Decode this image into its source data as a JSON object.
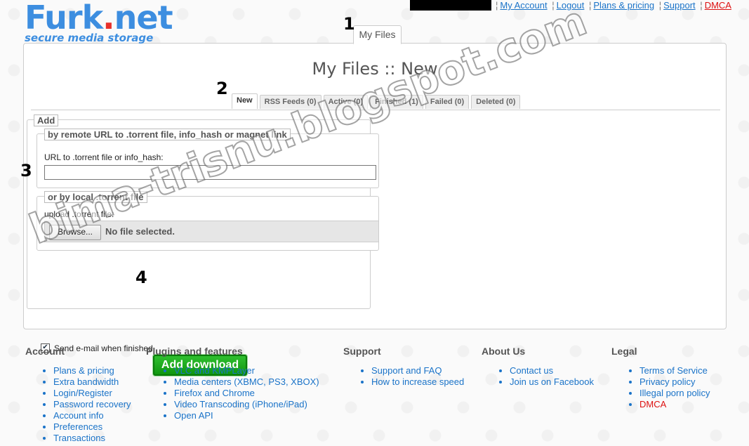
{
  "brand": {
    "name_main": "Furk",
    "name_dot": ".",
    "name_end": "net",
    "tagline": "secure media storage"
  },
  "topnav": {
    "sep": "¦",
    "items": [
      {
        "label": "My Account"
      },
      {
        "label": "Logout"
      },
      {
        "label": "Plans & pricing"
      },
      {
        "label": "Support"
      },
      {
        "label": "DMCA",
        "color": "#dd1111"
      }
    ]
  },
  "main_tab": {
    "label": "My Files"
  },
  "annotations": {
    "b1": "1",
    "b2": "2",
    "b3": "3",
    "b4": "4"
  },
  "page_title": "My Files :: New",
  "subtabs": [
    {
      "label": "New",
      "active": true
    },
    {
      "label": "RSS Feeds (0)"
    },
    {
      "label": "Active (0)"
    },
    {
      "label": "Finished (1)"
    },
    {
      "label": "Failed (0)"
    },
    {
      "label": "Deleted (0)"
    }
  ],
  "add_form": {
    "legend": "Add",
    "remote": {
      "legend": "by remote URL to .torrent file, info_hash or magnet link",
      "url_label": "URL to .torrent file or info_hash:",
      "url_value": ""
    },
    "local": {
      "legend": "or by local .torrent file",
      "upload_label": "upload .torrent file:",
      "browse_label": "Browse...",
      "no_file": "No file selected."
    },
    "email_checkbox": {
      "label": "Send e-mail when finished",
      "checked": true
    },
    "submit_label": "Add download"
  },
  "footer": {
    "account": {
      "title": "Account",
      "items": [
        "Plans & pricing",
        "Extra bandwidth",
        "Login/Register",
        "Password recovery",
        "Account info",
        "Preferences",
        "Transactions"
      ]
    },
    "plugins": {
      "title": "Plugins and features",
      "items": [
        "VLC and KMPLayer",
        "Media centers (XBMC, PS3, XBOX)",
        "Firefox and Chrome",
        "Video Transcoding (iPhone/iPad)",
        "Open API"
      ]
    },
    "support": {
      "title": "Support",
      "items": [
        "Support and FAQ",
        "How to increase speed"
      ]
    },
    "about": {
      "title": "About Us",
      "items": [
        "Contact us",
        "Join us on Facebook"
      ]
    },
    "legal": {
      "title": "Legal",
      "items": [
        "Terms of Service",
        "Privacy policy",
        "Illegal porn policy",
        "DMCA"
      ]
    }
  },
  "watermark": "bima-trisnu.blogspot.com",
  "colors": {
    "brand_blue": "#3d8ee0",
    "brand_red": "#e8312b",
    "link": "#1a73c8",
    "dmca_red": "#dd1111",
    "button_green": "#1aa51a"
  }
}
